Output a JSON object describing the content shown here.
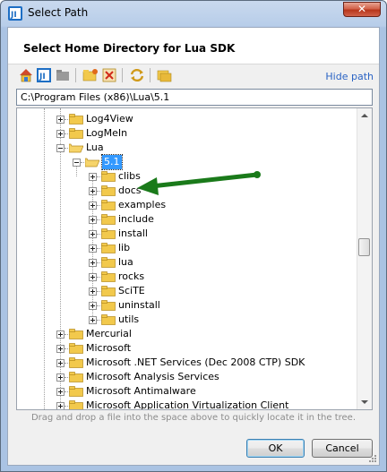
{
  "window": {
    "title": "Select Path",
    "close_label": "✕"
  },
  "header": {
    "title": "Select Home Directory for Lua SDK"
  },
  "toolbar": {
    "buttons": [
      "home-icon",
      "project-icon",
      "module-icon",
      "new-folder-icon",
      "delete-icon",
      "refresh-icon",
      "show-hidden-icon"
    ],
    "hide_path_label": "Hide path"
  },
  "path_field": {
    "value": "C:\\Program Files (x86)\\Lua\\5.1"
  },
  "tree": {
    "rows": [
      {
        "label": "Log4View",
        "depth": 0,
        "expanded": false
      },
      {
        "label": "LogMeIn",
        "depth": 0,
        "expanded": false
      },
      {
        "label": "Lua",
        "depth": 0,
        "expanded": true
      },
      {
        "label": "5.1",
        "depth": 1,
        "expanded": true,
        "selected": true
      },
      {
        "label": "clibs",
        "depth": 2,
        "expanded": false
      },
      {
        "label": "docs",
        "depth": 2,
        "expanded": false
      },
      {
        "label": "examples",
        "depth": 2,
        "expanded": false
      },
      {
        "label": "include",
        "depth": 2,
        "expanded": false
      },
      {
        "label": "install",
        "depth": 2,
        "expanded": false
      },
      {
        "label": "lib",
        "depth": 2,
        "expanded": false
      },
      {
        "label": "lua",
        "depth": 2,
        "expanded": false
      },
      {
        "label": "rocks",
        "depth": 2,
        "expanded": false
      },
      {
        "label": "SciTE",
        "depth": 2,
        "expanded": false
      },
      {
        "label": "uninstall",
        "depth": 2,
        "expanded": false
      },
      {
        "label": "utils",
        "depth": 2,
        "expanded": false
      },
      {
        "label": "Mercurial",
        "depth": 0,
        "expanded": false
      },
      {
        "label": "Microsoft",
        "depth": 0,
        "expanded": false
      },
      {
        "label": "Microsoft .NET Services (Dec 2008 CTP) SDK",
        "depth": 0,
        "expanded": false
      },
      {
        "label": "Microsoft Analysis Services",
        "depth": 0,
        "expanded": false
      },
      {
        "label": "Microsoft Antimalware",
        "depth": 0,
        "expanded": false
      },
      {
        "label": "Microsoft Application Virtualization Client",
        "depth": 0,
        "expanded": false
      }
    ]
  },
  "hint": "Drag and drop a file into the space above to quickly locate it in the tree.",
  "buttons": {
    "ok_label": "OK",
    "cancel_label": "Cancel"
  },
  "colors": {
    "selection": "#3399ff",
    "arrow": "#1a7a1a",
    "folder": "#f2c94c",
    "link": "#2a63c4"
  }
}
